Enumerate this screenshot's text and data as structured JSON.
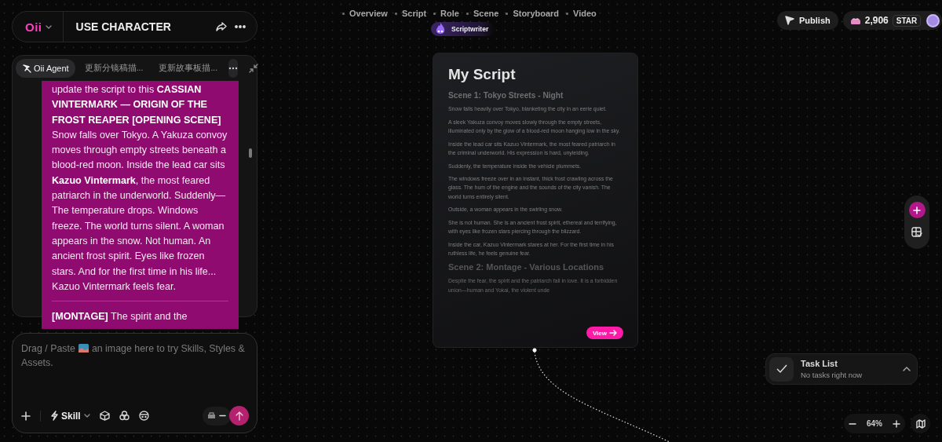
{
  "header": {
    "logo": "Oii",
    "title": "USE CHARACTER"
  },
  "agent_tabs": [
    {
      "label": "Oii Agent",
      "selected": true
    },
    {
      "label": "更新分镜稿描...",
      "selected": false
    },
    {
      "label": "更新故事板描...",
      "selected": false
    }
  ],
  "message": {
    "paragraphs": [
      "update the script to this **CASSIAN VINTERMARK — ORIGIN OF THE FROST REAPER [OPENING SCENE]** Snow falls over Tokyo. A Yakuza convoy moves through empty streets beneath a blood-red moon. Inside the lead car sits **Kazuo Vintermark**, the most feared patriarch in the underworld. Suddenly— The temperature drops. Windows freeze. The world turns silent. A woman appears in the snow. Not human. An ancient frost spirit. Eyes like frozen stars. And for the first time in his life... Kazuo Vintermark feels fear.",
      "**[MONTAGE]** The spirit and the"
    ]
  },
  "composer": {
    "placeholder_start": "Drag / Paste",
    "placeholder_end": "an image here to try Skills, Styles & Assets.",
    "skill": "Skill"
  },
  "nav": {
    "steps": [
      "Overview",
      "Script",
      "Role",
      "Scene",
      "Storyboard",
      "Video"
    ],
    "badge": "Scriptwriter"
  },
  "top_bar": {
    "publish": "Publish",
    "credits": "2,906",
    "currency": "STAR"
  },
  "script_card": {
    "title": "My Script",
    "blocks": [
      {
        "kind": "heading",
        "text": "Scene 1: Tokyo Streets - Night"
      },
      {
        "kind": "paragraph",
        "text": "Snow falls heavily over Tokyo, blanketing the city in an eerie quiet."
      },
      {
        "kind": "paragraph",
        "text": "A sleek Yakuza convoy moves slowly through the empty streets, illuminated only by the glow of a blood-red moon hanging low in the sky."
      },
      {
        "kind": "paragraph",
        "text": "Inside the lead car sits Kazuo Vintermark, the most feared patriarch in the criminal underworld. His expression is hard, unyielding."
      },
      {
        "kind": "paragraph",
        "text": "Suddenly, the temperature inside the vehicle plummets."
      },
      {
        "kind": "paragraph",
        "text": "The windows freeze over in an instant, thick frost crawling across the glass. The hum of the engine and the sounds of the city vanish. The world turns entirely silent."
      },
      {
        "kind": "paragraph",
        "text": "Outside, a woman appears in the swirling snow."
      },
      {
        "kind": "paragraph",
        "text": "She is not human. She is an ancient frost spirit, ethereal and terrifying, with eyes like frozen stars piercing through the blizzard."
      },
      {
        "kind": "paragraph",
        "text": "Inside the car, Kazuo Vintermark stares at her. For the first time in his ruthless life, he feels genuine fear."
      },
      {
        "kind": "heading",
        "text": "Scene 2: Montage - Various Locations"
      },
      {
        "kind": "paragraph",
        "text": "Despite the fear, the spirit and the patriarch fall in love. It is a forbidden union—human and Yokai, the violent unde"
      }
    ],
    "view": "View"
  },
  "task_list": {
    "title": "Task List",
    "status": "No tasks right now"
  },
  "zoom": {
    "value": "64%"
  }
}
